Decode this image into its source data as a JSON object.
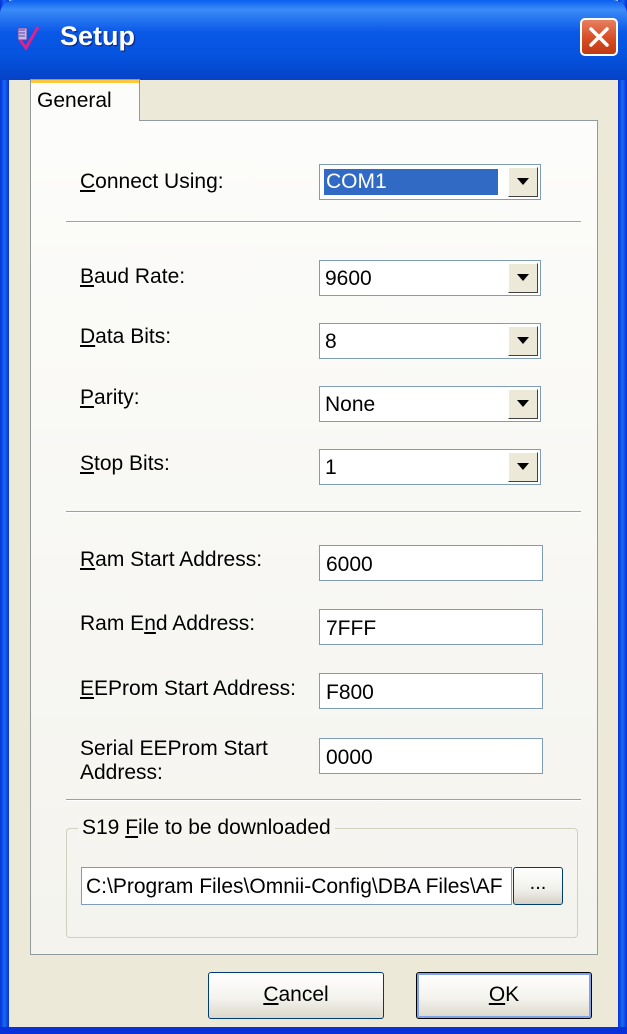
{
  "window": {
    "title": "Setup"
  },
  "tabs": [
    {
      "label": "General",
      "selected": true
    }
  ],
  "connection": {
    "connect_using": {
      "label_u": "C",
      "label_rest": "onnect Using:",
      "value": "COM1"
    }
  },
  "serial": {
    "baud_rate": {
      "label_u": "B",
      "label_rest": "aud Rate:",
      "value": "9600"
    },
    "data_bits": {
      "label_u": "D",
      "label_rest": "ata Bits:",
      "value": "8"
    },
    "parity": {
      "label_u": "P",
      "label_rest": "arity:",
      "value": "None"
    },
    "stop_bits": {
      "label_u": "S",
      "label_rest": "top Bits:",
      "value": "1"
    }
  },
  "memory": {
    "ram_start": {
      "label_u": "R",
      "label_rest": "am Start Address:",
      "value": "6000"
    },
    "ram_end": {
      "label_pre": "Ram E",
      "label_u": "n",
      "label_rest": "d Address:",
      "value": "7FFF"
    },
    "eeprom_start": {
      "label_u": "E",
      "label_rest": "EProm Start Address:",
      "value": "F800"
    },
    "serial_eeprom_start": {
      "label_line1": "Serial EEProm Start",
      "label_line2": "Address:",
      "value": "0000"
    }
  },
  "s19": {
    "group_pre": "S19 ",
    "group_u": "F",
    "group_rest": "ile to be downloaded",
    "path": "C:\\Program Files\\Omnii-Config\\DBA Files\\AF",
    "browse_label": "..."
  },
  "buttons": {
    "cancel_u": "C",
    "cancel_rest": "ancel",
    "ok_u": "O",
    "ok_rest": "K"
  },
  "colors": {
    "title_bar": "#0553DE",
    "close_button": "#D64C25",
    "tab_highlight": "#FFC83C",
    "selection": "#316AC5",
    "dialog_bg": "#ECE9D8"
  },
  "icons": {
    "app": "app-icon",
    "close": "close-icon",
    "dropdown": "chevron-down-icon"
  }
}
